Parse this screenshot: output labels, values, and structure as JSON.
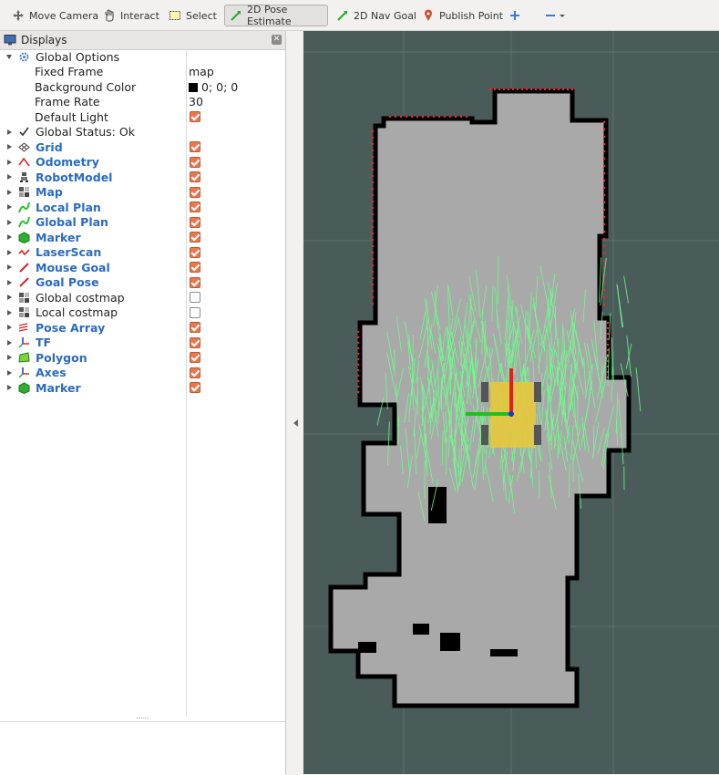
{
  "toolbar": {
    "tools": [
      {
        "label": "Move Camera",
        "icon": "move-camera-icon"
      },
      {
        "label": "Interact",
        "icon": "hand-icon"
      },
      {
        "label": "Select",
        "icon": "select-box-icon"
      },
      {
        "label": "2D Pose Estimate",
        "icon": "green-arrow-icon",
        "active": true
      },
      {
        "label": "2D Nav Goal",
        "icon": "green-arrow-icon"
      },
      {
        "label": "Publish Point",
        "icon": "map-pin-icon"
      },
      {
        "label": "",
        "icon": "plus-crosshair-icon"
      },
      {
        "label": "",
        "icon": "minus-dropdown-icon"
      }
    ]
  },
  "displays_panel": {
    "title": "Displays",
    "global_options": {
      "label": "Global Options",
      "fixed_frame": {
        "label": "Fixed Frame",
        "value": "map"
      },
      "background_color": {
        "label": "Background Color",
        "value": "0; 0; 0",
        "color": "#000000"
      },
      "frame_rate": {
        "label": "Frame Rate",
        "value": "30"
      },
      "default_light": {
        "label": "Default Light",
        "checked": true
      }
    },
    "global_status": {
      "label": "Global Status: Ok"
    },
    "items": [
      {
        "label": "Grid",
        "icon": "grid-icon",
        "checked": true,
        "plugin": true
      },
      {
        "label": "Odometry",
        "icon": "odometry-icon",
        "checked": true,
        "plugin": true
      },
      {
        "label": "RobotModel",
        "icon": "robot-model-icon",
        "checked": true,
        "plugin": true
      },
      {
        "label": "Map",
        "icon": "map-icon",
        "checked": true,
        "plugin": true
      },
      {
        "label": "Local Plan",
        "icon": "path-icon",
        "checked": true,
        "plugin": true
      },
      {
        "label": "Global Plan",
        "icon": "path-icon",
        "checked": true,
        "plugin": true
      },
      {
        "label": "Marker",
        "icon": "marker-cube-icon",
        "checked": true,
        "plugin": true
      },
      {
        "label": "LaserScan",
        "icon": "laser-scan-icon",
        "checked": true,
        "plugin": true
      },
      {
        "label": "Mouse Goal",
        "icon": "pose-arrow-icon",
        "checked": true,
        "plugin": true
      },
      {
        "label": "Goal Pose",
        "icon": "pose-arrow-icon",
        "checked": true,
        "plugin": true
      },
      {
        "label": "Global costmap",
        "icon": "map-icon",
        "checked": false,
        "plugin": false
      },
      {
        "label": "Local costmap",
        "icon": "map-icon",
        "checked": false,
        "plugin": false
      },
      {
        "label": "Pose Array",
        "icon": "pose-array-icon",
        "checked": true,
        "plugin": true
      },
      {
        "label": "TF",
        "icon": "tf-axes-icon",
        "checked": true,
        "plugin": true
      },
      {
        "label": "Polygon",
        "icon": "polygon-icon",
        "checked": true,
        "plugin": true
      },
      {
        "label": "Axes",
        "icon": "axes-icon",
        "checked": true,
        "plugin": true
      },
      {
        "label": "Marker",
        "icon": "marker-cube-icon",
        "checked": true,
        "plugin": true
      }
    ]
  },
  "colors": {
    "accent_link": "#2a6bc0",
    "checkbox_on": "#e8794f",
    "viewport_bg": "#4a5c5a",
    "map_free": "#a9a9a9",
    "map_wall": "#000000",
    "particles": "#6dff8a",
    "robot_footprint": "#e8c63c",
    "laser_points": "#ff2020"
  }
}
